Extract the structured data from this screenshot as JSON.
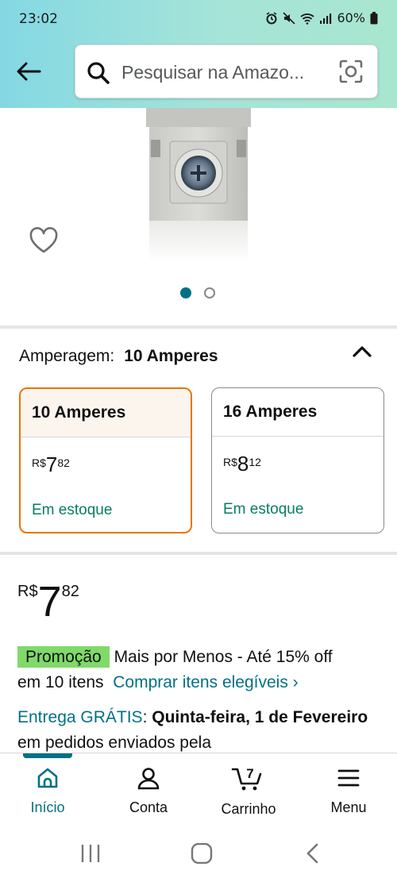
{
  "status_bar": {
    "time": "23:02",
    "battery": "60%"
  },
  "search": {
    "placeholder": "Pesquisar na Amazo..."
  },
  "variation": {
    "label": "Amperagem:",
    "selected_value": "10 Amperes"
  },
  "options": [
    {
      "name": "10 Amperes",
      "currency": "R$",
      "price_whole": "7",
      "price_fraction": "82",
      "stock": "Em estoque"
    },
    {
      "name": "16 Amperes",
      "currency": "R$",
      "price_whole": "8",
      "price_fraction": "12",
      "stock": "Em estoque"
    }
  ],
  "price": {
    "currency": "R$",
    "whole": "7",
    "fraction": "82"
  },
  "promo": {
    "badge": "Promoção",
    "text_line1": "Mais por Menos - Até 15% off",
    "text_line2": "em 10 itens",
    "link": "Comprar itens elegíveis ›"
  },
  "delivery": {
    "link": "Entrega GRÁTIS",
    "colon": ":",
    "date": "Quinta-feira, 1 de Fevereiro",
    "rest": "em pedidos enviados pela"
  },
  "bottom_nav": {
    "items": [
      {
        "label": "Início",
        "icon": "home-icon"
      },
      {
        "label": "Conta",
        "icon": "user-icon"
      },
      {
        "label": "Carrinho",
        "icon": "cart-icon",
        "badge": "7"
      },
      {
        "label": "Menu",
        "icon": "menu-icon"
      }
    ]
  },
  "colors": {
    "teal": "#007185",
    "orange": "#e77600",
    "green_stock": "#067d62",
    "promo_green": "#7fda69"
  }
}
